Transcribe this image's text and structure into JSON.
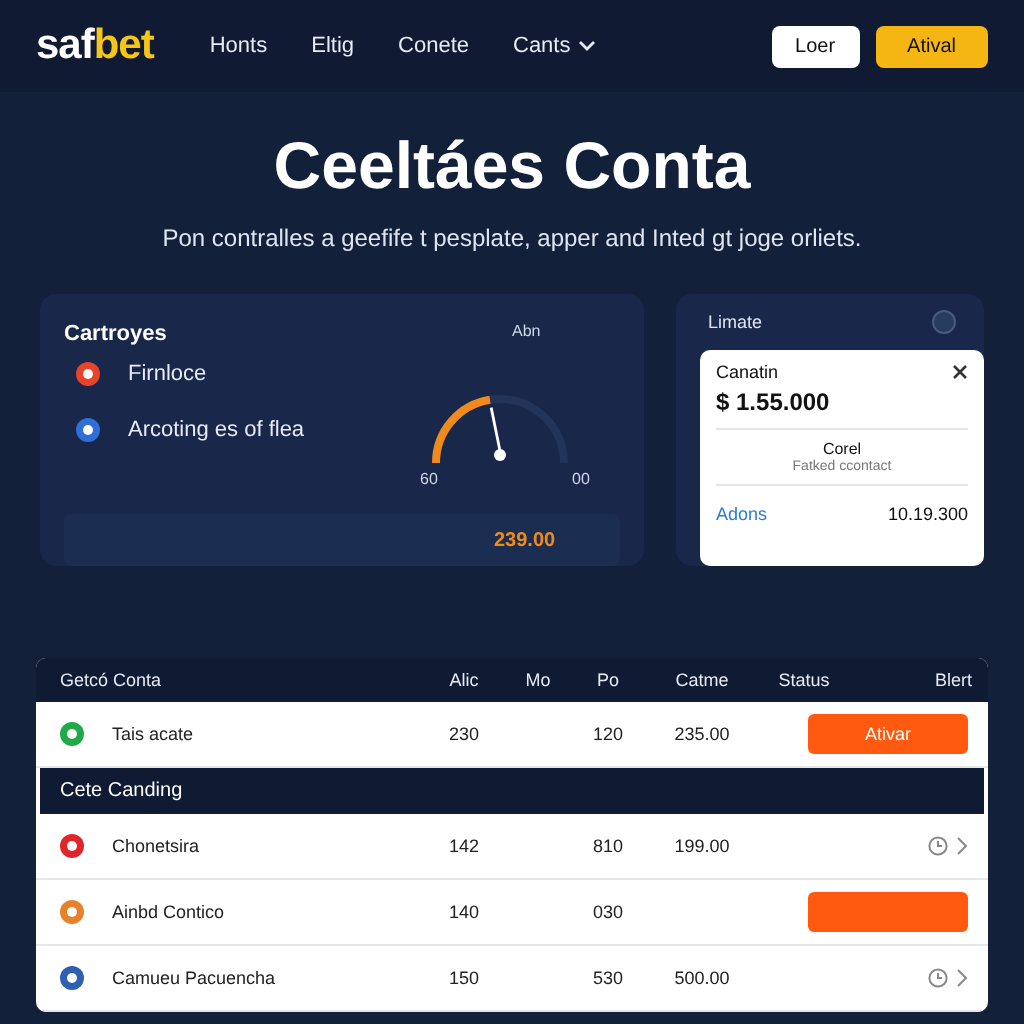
{
  "header": {
    "logo_left": "saf",
    "logo_right": "bet",
    "nav": [
      {
        "label": "Honts",
        "dropdown": false
      },
      {
        "label": "Eltig",
        "dropdown": false
      },
      {
        "label": "Conete",
        "dropdown": false
      },
      {
        "label": "Cants",
        "dropdown": true
      }
    ],
    "login": "Loer",
    "register": "Atival"
  },
  "hero": {
    "title": "Ceeltáes Conta",
    "subtitle": "Pon contralles a geefife t pesplate, apper and Inted gt joge orliets."
  },
  "categories": {
    "title": "Cartroyes",
    "items": [
      {
        "label": "Firnloce",
        "color": "#e8442a"
      },
      {
        "label": "Arcoting es of flea",
        "color": "#2f6fd6"
      }
    ],
    "gauge": {
      "label": "Abn",
      "min": "60",
      "max": "00",
      "level": 0.45
    },
    "total": "239.00"
  },
  "summary": {
    "title": "Limate",
    "popup": {
      "label": "Canatin",
      "amount": "$ 1.55.000",
      "caption": "Corel",
      "note": "Fatked ccontact",
      "link": "Adons",
      "value": "10.19.300"
    }
  },
  "table": {
    "columns": [
      "Getcó Conta",
      "Alic",
      "Mo",
      "Po",
      "Catme",
      "Status",
      "Blert"
    ],
    "rows": [
      {
        "kind": "row",
        "name": "Tais acate",
        "color": "#1faa4a",
        "c1": "230",
        "c2": "120",
        "c3": "235.00",
        "action": "Ativar"
      },
      {
        "kind": "section",
        "name": "Cete Canding"
      },
      {
        "kind": "row",
        "name": "Chonetsira",
        "color": "#e0262b",
        "c1": "142",
        "c2": "810",
        "c3": "199.00"
      },
      {
        "kind": "row",
        "name": "Ainbd Contico",
        "color": "#e8822a",
        "c1": "140",
        "c2": "030",
        "action": ""
      },
      {
        "kind": "row",
        "name": "Camueu Pacuencha",
        "color": "#2f5fb0",
        "c1": "150",
        "c2": "530",
        "c3": "500.00"
      }
    ]
  }
}
